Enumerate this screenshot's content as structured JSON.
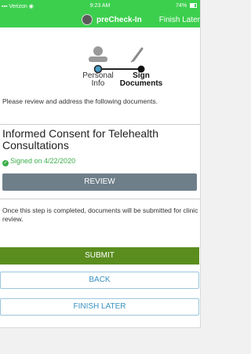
{
  "status_bar": {
    "carrier": "Verizon",
    "time": "9:23 AM",
    "battery": "74%"
  },
  "nav": {
    "title": "preCheck-In",
    "finish_later": "Finish Later"
  },
  "stepper": {
    "steps": [
      {
        "line1": "Personal",
        "line2": "Info",
        "active": false
      },
      {
        "line1": "Sign",
        "line2": "Documents",
        "active": true
      }
    ]
  },
  "instruction": "Please review and address the following documents.",
  "document": {
    "title": "Informed Consent for Telehealth Consultations",
    "signed_text": "Signed on 4/22/2020",
    "review_label": "REVIEW"
  },
  "note": "Once this step is completed, documents will be submitted for clinic review.",
  "buttons": {
    "submit": "SUBMIT",
    "back": "BACK",
    "finish_later": "FINISH LATER"
  },
  "colors": {
    "header_green": "#3ccf4e",
    "submit_green": "#5a8d1e",
    "review_gray": "#6e7f8a",
    "link_blue": "#3a93c0",
    "stepper_blue": "#4a9cc6"
  }
}
